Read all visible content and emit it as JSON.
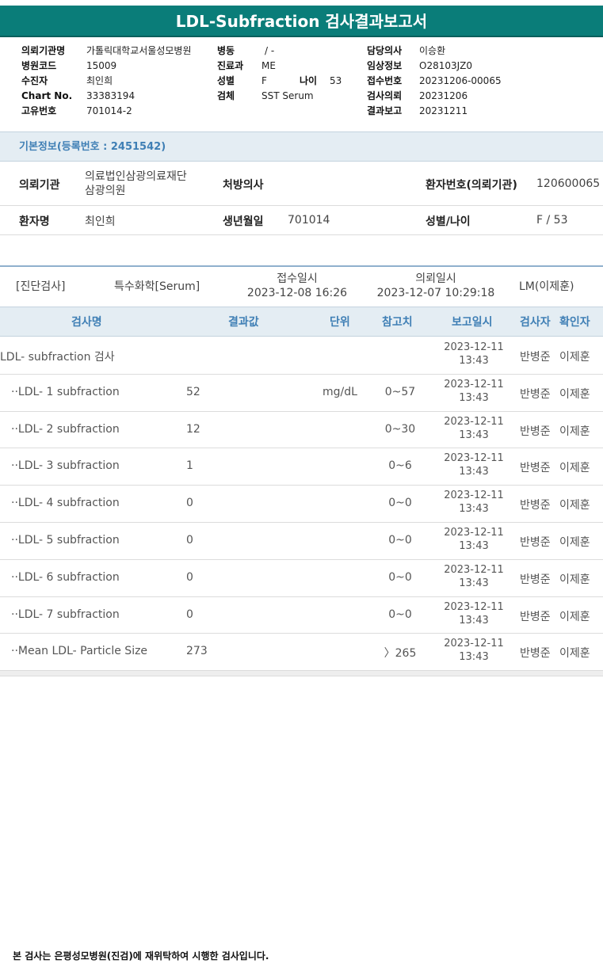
{
  "title": "LDL-Subfraction 검사결과보고서",
  "header": {
    "col1": [
      {
        "label": "의뢰기관명",
        "value": "가톨릭대학교서울성모병원"
      },
      {
        "label": "병원코드",
        "value": "15009"
      },
      {
        "label": "수진자",
        "value": "최인희"
      },
      {
        "label": "Chart No.",
        "value": "33383194"
      },
      {
        "label": "고유번호",
        "value": "701014-2"
      }
    ],
    "col2": [
      {
        "label": "병동",
        "value": "/ -"
      },
      {
        "label": "진료과",
        "value": "ME"
      },
      {
        "label": "성별",
        "value": "F"
      },
      {
        "label": "검체",
        "value": "SST Serum"
      }
    ],
    "age_label": "나이",
    "age_value": "53",
    "col3": [
      {
        "label": "담당의사",
        "value": "이승환"
      },
      {
        "label": "임상정보",
        "value": "O28103JZ0"
      },
      {
        "label": "접수번호",
        "value": "20231206-00065"
      },
      {
        "label": "검사의뢰",
        "value": "20231206"
      },
      {
        "label": "결과보고",
        "value": "20231211"
      }
    ]
  },
  "basic_info": {
    "heading": "기본정보(등록번호 : 2451542)",
    "institution_label": "의뢰기관",
    "institution_line1": "의료법인삼광의료재단",
    "institution_line2": "삼광의원",
    "doctor_label": "처방의사",
    "doctor_value": "",
    "patient_no_label": "환자번호(의뢰기관)",
    "patient_no_value": "120600065",
    "name_label": "환자명",
    "name_value": "최인희",
    "birth_label": "생년월일",
    "birth_value": "701014",
    "sexage_label": "성별/나이",
    "sexage_value": "F / 53"
  },
  "meta": {
    "category": "[진단검사]",
    "specimen": "특수화학[Serum]",
    "received_label": "접수일시",
    "received_value": "2023-12-08 16:26",
    "requested_label": "의뢰일시",
    "requested_value": "2023-12-07 10:29:18",
    "lab": "LM(이제훈)"
  },
  "table": {
    "headers": {
      "name": "검사명",
      "value": "결과값",
      "unit": "단위",
      "ref": "참고치",
      "date": "보고일시",
      "tester": "검사자",
      "confirmer": "확인자"
    },
    "rows": [
      {
        "name": "LDL- subfraction 검사",
        "value": "",
        "unit": "",
        "ref": "",
        "date1": "2023-12-11",
        "date2": "13:43",
        "tester": "반병준",
        "confirmer": "이제훈"
      },
      {
        "name": "··LDL- 1 subfraction",
        "value": "52",
        "unit": "mg/dL",
        "ref": "0~57",
        "date1": "2023-12-11",
        "date2": "13:43",
        "tester": "반병준",
        "confirmer": "이제훈"
      },
      {
        "name": "··LDL- 2 subfraction",
        "value": "12",
        "unit": "",
        "ref": "0~30",
        "date1": "2023-12-11",
        "date2": "13:43",
        "tester": "반병준",
        "confirmer": "이제훈"
      },
      {
        "name": "··LDL- 3 subfraction",
        "value": "1",
        "unit": "",
        "ref": "0~6",
        "date1": "2023-12-11",
        "date2": "13:43",
        "tester": "반병준",
        "confirmer": "이제훈"
      },
      {
        "name": "··LDL- 4 subfraction",
        "value": "0",
        "unit": "",
        "ref": "0~0",
        "date1": "2023-12-11",
        "date2": "13:43",
        "tester": "반병준",
        "confirmer": "이제훈"
      },
      {
        "name": "··LDL- 5 subfraction",
        "value": "0",
        "unit": "",
        "ref": "0~0",
        "date1": "2023-12-11",
        "date2": "13:43",
        "tester": "반병준",
        "confirmer": "이제훈"
      },
      {
        "name": "··LDL- 6 subfraction",
        "value": "0",
        "unit": "",
        "ref": "0~0",
        "date1": "2023-12-11",
        "date2": "13:43",
        "tester": "반병준",
        "confirmer": "이제훈"
      },
      {
        "name": "··LDL- 7 subfraction",
        "value": "0",
        "unit": "",
        "ref": "0~0",
        "date1": "2023-12-11",
        "date2": "13:43",
        "tester": "반병준",
        "confirmer": "이제훈"
      },
      {
        "name": "··Mean LDL- Particle Size",
        "value": "273",
        "unit": "",
        "ref": "〉265",
        "date1": "2023-12-11",
        "date2": "13:43",
        "tester": "반병준",
        "confirmer": "이제훈"
      }
    ]
  },
  "footer": "본 검사는 은평성모병원(진검)에 재위탁하여 시행한 검사입니다."
}
